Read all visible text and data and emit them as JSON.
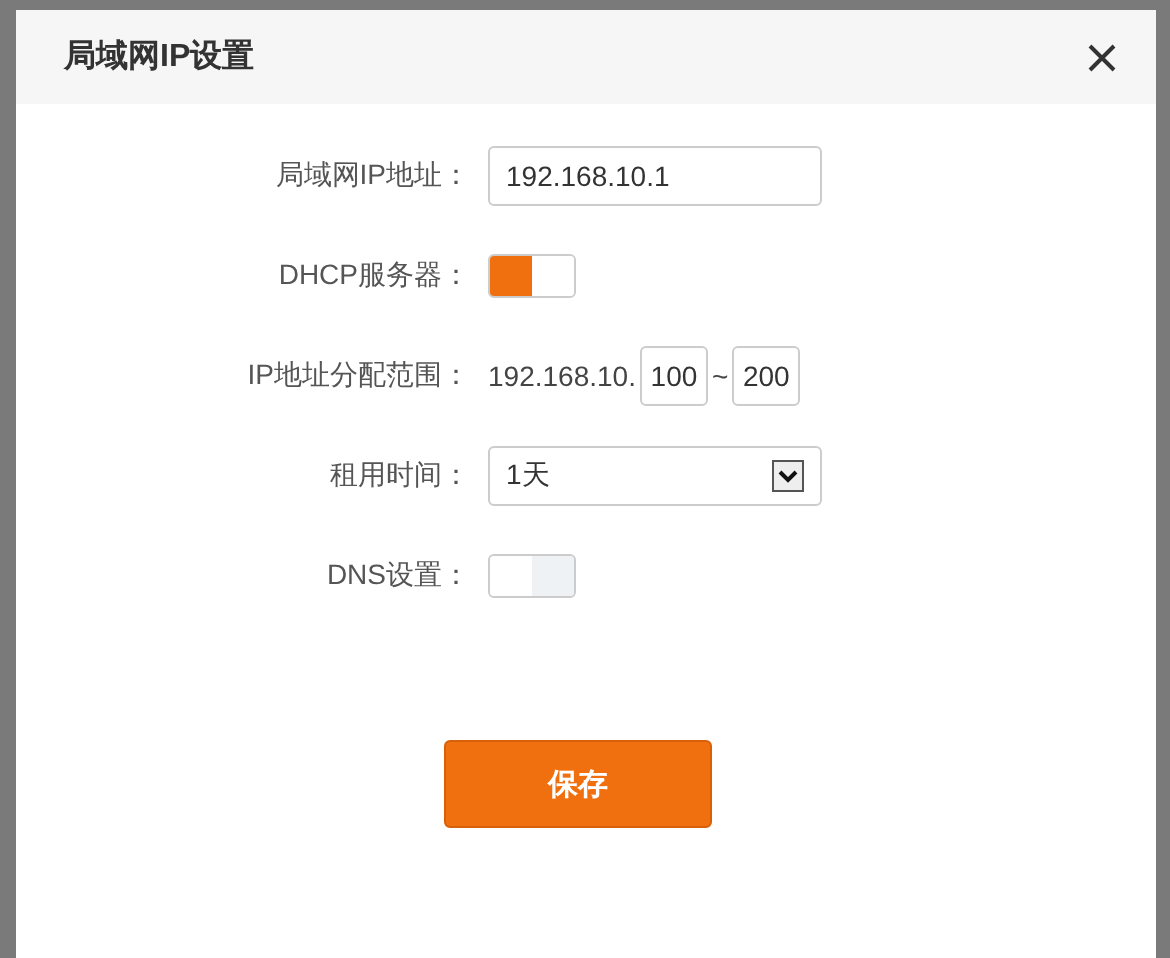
{
  "dialog": {
    "title": "局域网IP设置",
    "fields": [
      {
        "kind": "text",
        "label": "局域网IP地址：",
        "value": "192.168.10.1"
      },
      {
        "kind": "toggle",
        "label": "DHCP服务器：",
        "on": true
      },
      {
        "kind": "range",
        "label": "IP地址分配范围：",
        "prefix": "192.168.10.",
        "start": "100",
        "separator": "~",
        "end": "200"
      },
      {
        "kind": "select",
        "label": "租用时间：",
        "value": "1天"
      },
      {
        "kind": "toggle",
        "label": "DNS设置：",
        "on": false
      }
    ],
    "save_button": "保存"
  }
}
